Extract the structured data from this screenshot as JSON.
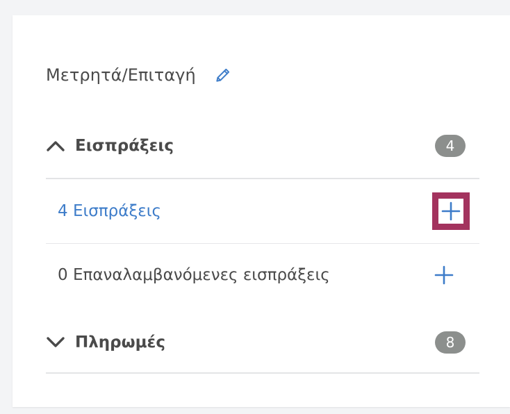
{
  "header": {
    "title": "Μετρητά/Επιταγή",
    "edit_icon": "pencil-icon"
  },
  "sections": [
    {
      "label": "Εισπράξεις",
      "count": "4",
      "expanded": true,
      "items": [
        {
          "label": "4 Εισπράξεις",
          "is_link": true
        },
        {
          "label": "0 Επαναλαμβανόμενες εισπράξεις",
          "is_link": false
        }
      ]
    },
    {
      "label": "Πληρωμές",
      "count": "8",
      "expanded": false
    }
  ],
  "colors": {
    "accent": "#3d7cc9",
    "highlight": "#a3335e",
    "badge": "#8c8f8d",
    "text": "#4a4a4a"
  }
}
